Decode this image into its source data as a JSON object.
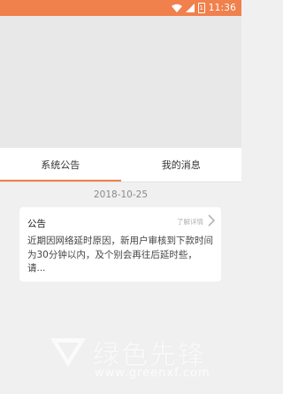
{
  "status_bar": {
    "time": "11:36",
    "battery_level": "1",
    "icons": [
      "wifi-icon",
      "signal-icon",
      "battery-icon"
    ],
    "color": "#f0804c"
  },
  "tabs": [
    {
      "label": "系统公告",
      "active": true
    },
    {
      "label": "我的消息",
      "active": false
    }
  ],
  "accent_color": "#f0804c",
  "notices": [
    {
      "date": "2018-10-25",
      "title": "公告",
      "more_label": "了解详情",
      "body": "近期因网络延时原因，新用户审核到下款时间为30分钟以内，及个别会再往后延时些，请..."
    }
  ],
  "watermark": {
    "text": "绿色先锋",
    "url": "www.greenxf.com"
  }
}
